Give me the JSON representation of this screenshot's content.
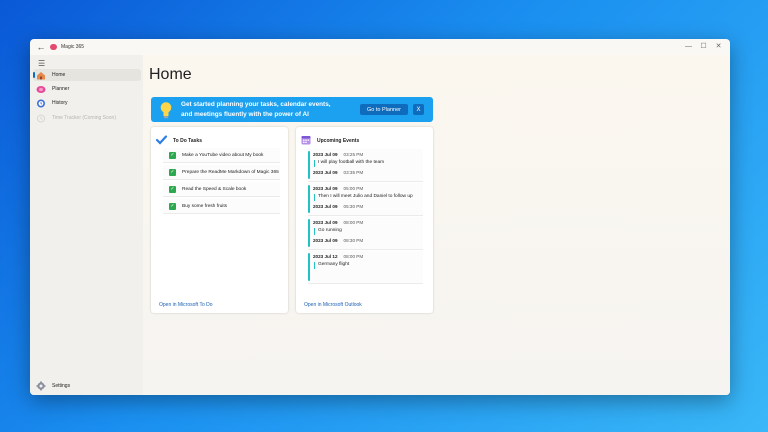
{
  "app": {
    "title": "Magic 365",
    "back_glyph": "←",
    "logo_color": "#e24b6e"
  },
  "window_controls": {
    "minimize": "—",
    "maximize": "☐",
    "close": "✕"
  },
  "sidebar": {
    "menu_glyph": "☰",
    "items": [
      {
        "label": "Home",
        "icon": "home-icon",
        "active": true
      },
      {
        "label": "Planner",
        "icon": "planner-icon",
        "active": false
      },
      {
        "label": "History",
        "icon": "history-icon",
        "active": false
      },
      {
        "label": "Time Tracker (Coming Soon)",
        "icon": "clock-icon",
        "active": false,
        "disabled": true
      }
    ],
    "settings_label": "Settings"
  },
  "main": {
    "title": "Home"
  },
  "banner": {
    "line1": "Get started planning your tasks, calendar events,",
    "line2": "and meetings fluently with the power of AI",
    "button_label": "Go to Planner",
    "close_label": "X",
    "color": "#1ba1ef"
  },
  "todo": {
    "title": "To Do Tasks",
    "check_glyph": "✓",
    "tasks": [
      "Make a YouTube video about My book",
      "Prepare the ReadMe Markdown of Magic 365",
      "Read the Speed & Scale book",
      "Buy some fresh fruits"
    ],
    "link": "Open in Microsoft To Do"
  },
  "events": {
    "title": "Upcoming Events",
    "items": [
      {
        "date1": "2023 Jul 09",
        "time1": "03:25 PM",
        "title": "I will play football with the team",
        "date2": "2023 Jul 09",
        "time2": "03:35 PM"
      },
      {
        "date1": "2023 Jul 09",
        "time1": "05:00 PM",
        "title": "Then I will meet Julio and Daniel to follow up",
        "date2": "2023 Jul 09",
        "time2": "05:30 PM"
      },
      {
        "date1": "2023 Jul 09",
        "time1": "08:00 PM",
        "title": "Go running",
        "date2": "2023 Jul 09",
        "time2": "08:30 PM"
      },
      {
        "date1": "2023 Jul 12",
        "time1": "08:00 PM",
        "title": "Germany flight",
        "date2": "",
        "time2": ""
      }
    ],
    "link": "Open in Microsoft Outlook"
  },
  "colors": {
    "accent": "#0f6cbd",
    "event_bar": "#22c1c3",
    "task_check": "#2ea84f"
  }
}
